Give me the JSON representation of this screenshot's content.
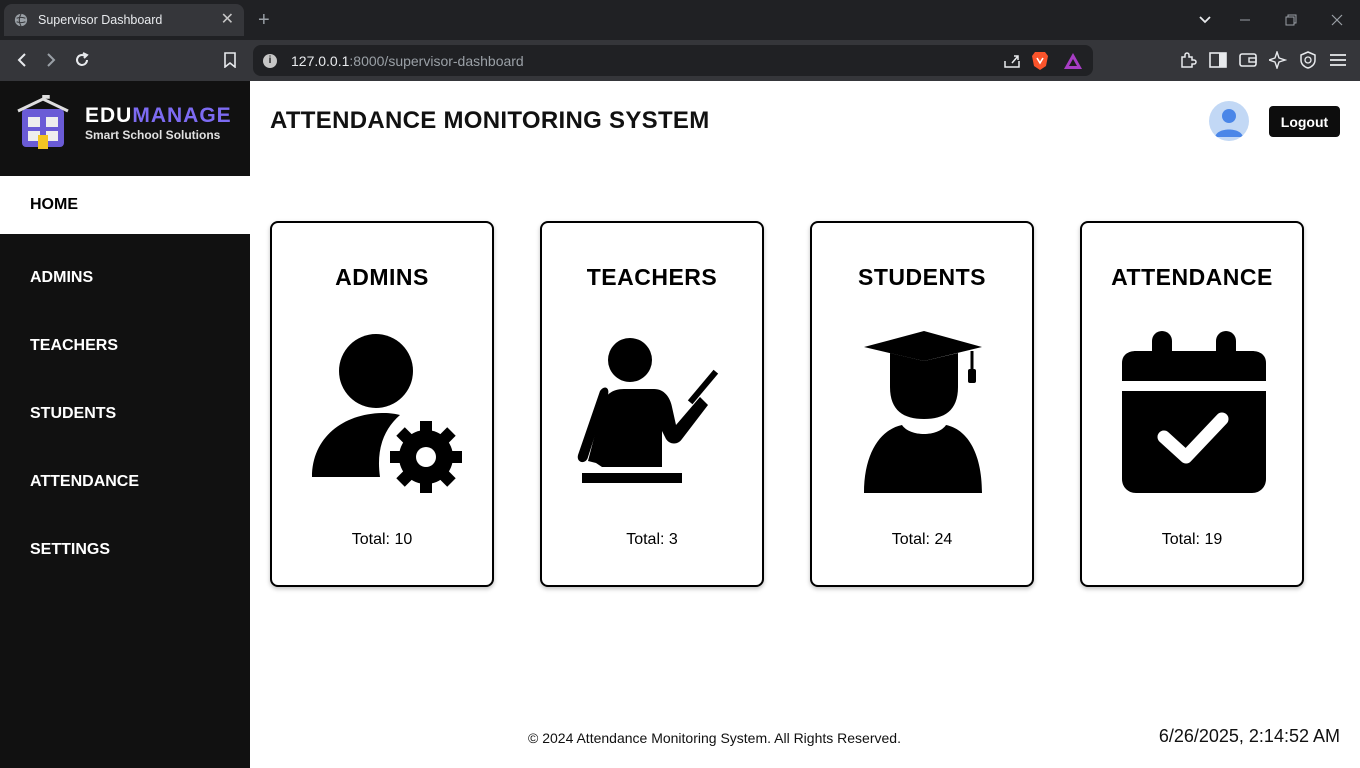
{
  "browser": {
    "tab_title": "Supervisor Dashboard",
    "url_host": "127.0.0.1",
    "url_rest": ":8000/supervisor-dashboard"
  },
  "brand": {
    "name_part1": "EDU",
    "name_part2": "MANAGE",
    "tagline": "Smart School Solutions"
  },
  "nav": {
    "items": [
      {
        "label": "HOME",
        "active": true
      },
      {
        "label": "ADMINS"
      },
      {
        "label": "TEACHERS"
      },
      {
        "label": "STUDENTS"
      },
      {
        "label": "ATTENDANCE"
      },
      {
        "label": "SETTINGS"
      }
    ]
  },
  "header": {
    "title": "ATTENDANCE MONITORING SYSTEM",
    "logout_label": "Logout"
  },
  "cards": [
    {
      "title": "ADMINS",
      "total": "Total: 10",
      "icon": "admin-gear-icon"
    },
    {
      "title": "TEACHERS",
      "total": "Total: 3",
      "icon": "teacher-icon"
    },
    {
      "title": "STUDENTS",
      "total": "Total: 24",
      "icon": "graduate-icon"
    },
    {
      "title": "ATTENDANCE",
      "total": "Total: 19",
      "icon": "calendar-check-icon"
    }
  ],
  "footer": {
    "copyright": "© 2024 Attendance Monitoring System. All Rights Reserved.",
    "datetime": "6/26/2025, 2:14:52 AM"
  },
  "colors": {
    "sidebar_bg": "#111111",
    "brand_accent": "#7d6bf2",
    "logout_bg": "#0d0d0d"
  }
}
